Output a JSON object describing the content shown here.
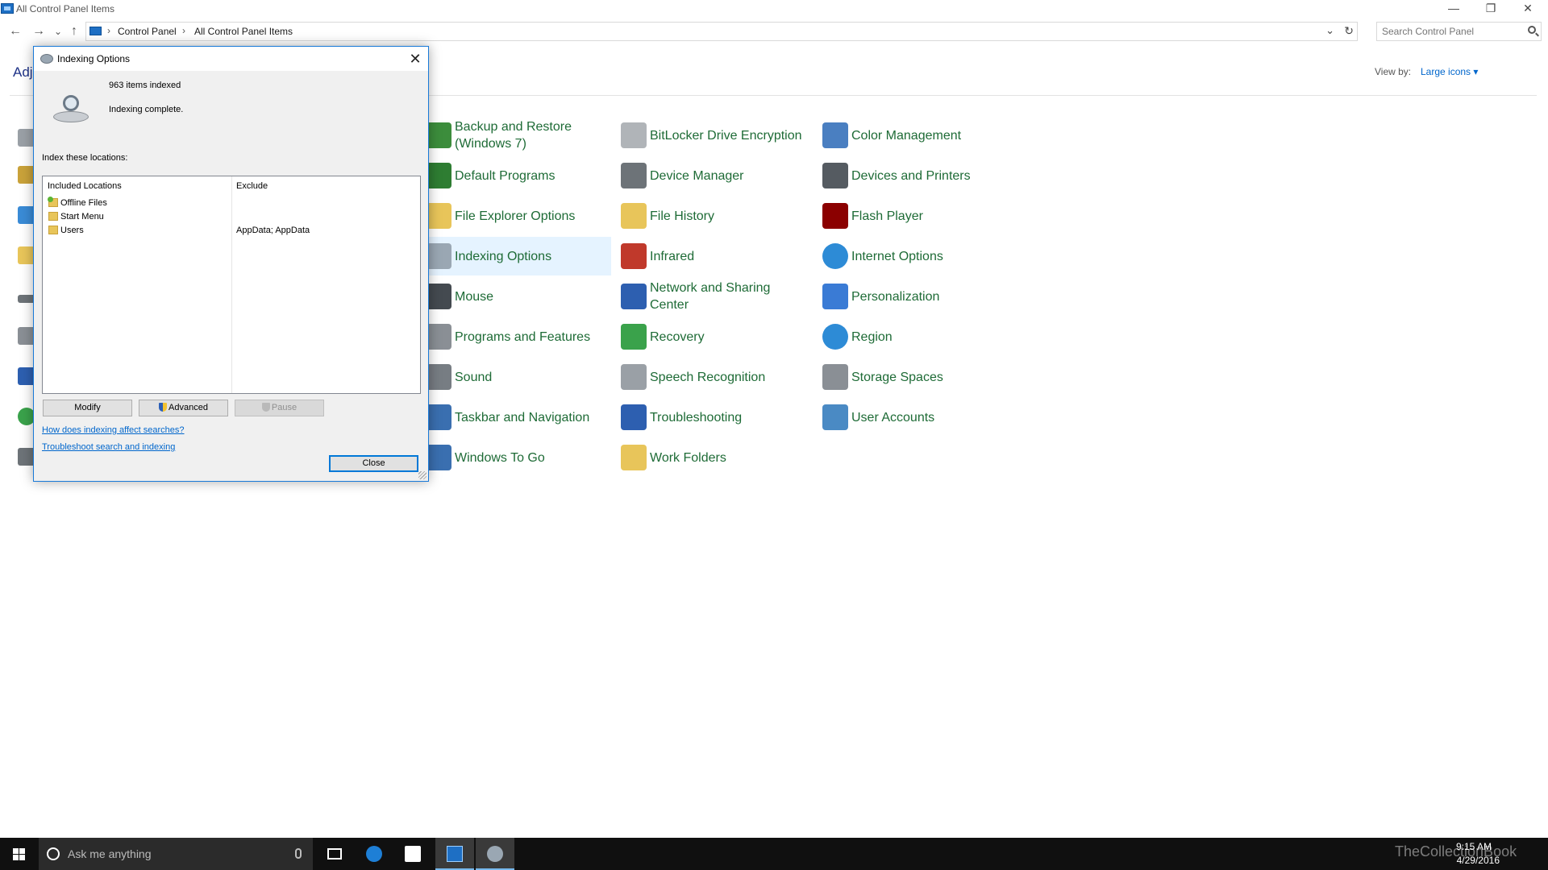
{
  "window": {
    "title": "All Control Panel Items",
    "minimize": "—",
    "restore": "❐",
    "close": "✕"
  },
  "nav": {
    "back": "←",
    "forward": "→",
    "recent": "⌄",
    "up": "↑"
  },
  "address": {
    "crumbs": [
      "Control Panel",
      "All Control Panel Items"
    ],
    "separator": "›",
    "dropdown": "⌄",
    "refresh": "↻"
  },
  "search": {
    "placeholder": "Search Control Panel"
  },
  "heading": "Adj",
  "view_by": {
    "label": "View by:",
    "value": "Large icons ▾"
  },
  "items": [
    {
      "label": "Backup and Restore (Windows 7)",
      "color": "#3c8d3c"
    },
    {
      "label": "BitLocker Drive Encryption",
      "color": "#b0b4b8"
    },
    {
      "label": "Color Management",
      "color": "#4a7fc1"
    },
    {
      "label": "Default Programs",
      "color": "#2e7d32"
    },
    {
      "label": "Device Manager",
      "color": "#6d7378"
    },
    {
      "label": "Devices and Printers",
      "color": "#555b61"
    },
    {
      "label": "File Explorer Options",
      "color": "#e8c55a"
    },
    {
      "label": "File History",
      "color": "#e8c55a"
    },
    {
      "label": "Flash Player",
      "color": "#8b0000"
    },
    {
      "label": "Indexing Options",
      "color": "#9aa7b3"
    },
    {
      "label": "Infrared",
      "color": "#c0392b"
    },
    {
      "label": "Internet Options",
      "color": "#2d8bd6"
    },
    {
      "label": "Mouse",
      "color": "#444a50"
    },
    {
      "label": "Network and Sharing Center",
      "color": "#2d5fb0"
    },
    {
      "label": "Personalization",
      "color": "#3a7bd5"
    },
    {
      "label": "Programs and Features",
      "color": "#8a8f95"
    },
    {
      "label": "Recovery",
      "color": "#3aa24b"
    },
    {
      "label": "Region",
      "color": "#2d8bd6"
    },
    {
      "label": "Sound",
      "color": "#777d83"
    },
    {
      "label": "Speech Recognition",
      "color": "#9aa0a6"
    },
    {
      "label": "Storage Spaces",
      "color": "#8a8f95"
    },
    {
      "label": "Taskbar and Navigation",
      "color": "#3a6fb0"
    },
    {
      "label": "Troubleshooting",
      "color": "#2d5fb0"
    },
    {
      "label": "User Accounts",
      "color": "#4a8ac4"
    },
    {
      "label": "Windows To Go",
      "color": "#3a6fb0"
    },
    {
      "label": "Work Folders",
      "color": "#e8c55a"
    }
  ],
  "dialog": {
    "title": "Indexing Options",
    "close": "✕",
    "items_indexed": "963 items indexed",
    "status": "Indexing complete.",
    "locations_label": "Index these locations:",
    "headers": {
      "included": "Included Locations",
      "exclude": "Exclude"
    },
    "rows": [
      {
        "name": "Offline Files",
        "exclude": ""
      },
      {
        "name": "Start Menu",
        "exclude": ""
      },
      {
        "name": "Users",
        "exclude": "AppData; AppData"
      }
    ],
    "buttons": {
      "modify": "Modify",
      "advanced": "Advanced",
      "pause": "Pause",
      "close": "Close"
    },
    "links": {
      "how": "How does indexing affect searches?",
      "troubleshoot": "Troubleshoot search and indexing"
    }
  },
  "taskbar": {
    "search_text": "Ask me anything",
    "time": "9:15 AM",
    "date": "4/29/2016",
    "watermark": "TheCollectionBook"
  }
}
